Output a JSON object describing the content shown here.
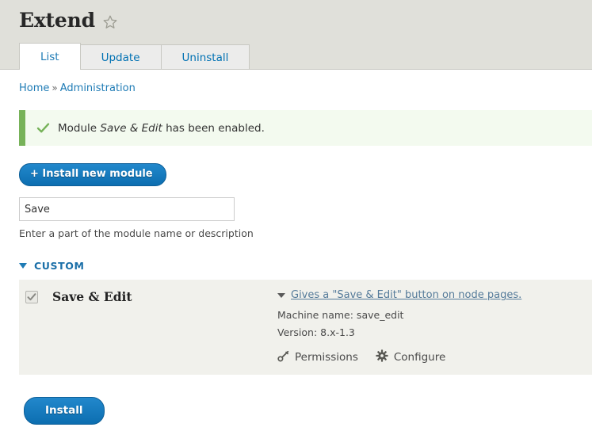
{
  "header": {
    "title": "Extend",
    "star_icon": "star-outline-icon"
  },
  "tabs": [
    {
      "label": "List",
      "active": true
    },
    {
      "label": "Update",
      "active": false
    },
    {
      "label": "Uninstall",
      "active": false
    }
  ],
  "breadcrumb": {
    "items": [
      "Home",
      "Administration"
    ],
    "separator": "»"
  },
  "status_message": {
    "icon": "check-icon",
    "prefix": "Module ",
    "module": "Save & Edit",
    "suffix": " has been enabled."
  },
  "actions": {
    "install_new_module": "+ Install new module",
    "install_submit": "Install"
  },
  "filter": {
    "value": "Save",
    "placeholder": "",
    "description": "Enter a part of the module name or description"
  },
  "package": {
    "title": "CUSTOM",
    "expanded": true,
    "toggle_icon": "triangle-down-icon"
  },
  "module": {
    "checkbox_checked": true,
    "checkbox_disabled": true,
    "name": "Save & Edit",
    "description": "Gives a \"Save & Edit\" button on node pages.",
    "machine_name_label": "Machine name: save_edit",
    "version_label": "Version: 8.x-1.3",
    "links": [
      {
        "label": "Permissions",
        "icon": "key-icon"
      },
      {
        "label": "Configure",
        "icon": "gear-icon"
      }
    ]
  },
  "colors": {
    "header_bg": "#e0e0da",
    "accent_blue": "#1e7bb5",
    "button_blue": "#1279bf",
    "status_green_border": "#77b259",
    "status_green_bg": "#f3faef",
    "table_row_bg": "#f1f1ec"
  }
}
